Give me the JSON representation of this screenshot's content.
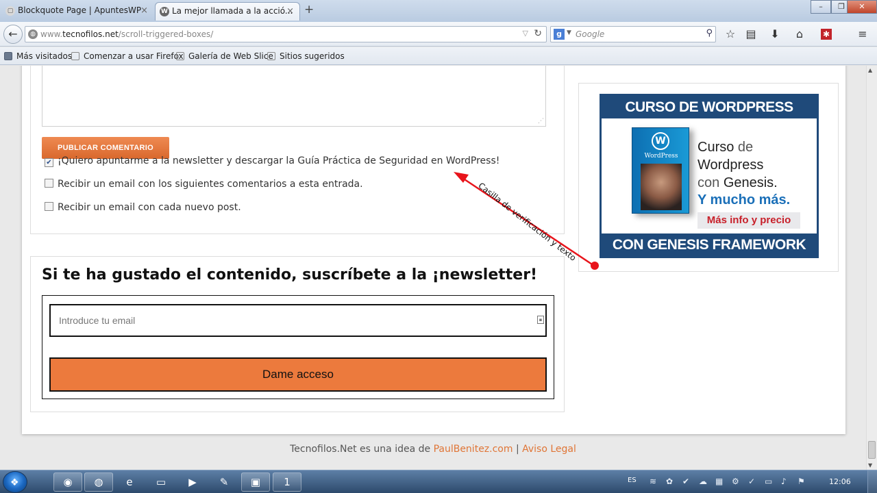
{
  "browser": {
    "tabs": [
      {
        "label": "Blockquote Page | ApuntesWP",
        "close": "×"
      },
      {
        "label": "La mejor llamada a la acció...",
        "close": "×"
      }
    ],
    "new_tab": "+",
    "window_controls": {
      "minimize": "–",
      "maximize": "❐",
      "close": "✕"
    },
    "url_prefix": "www.",
    "url_domain": "tecnofilos.net",
    "url_path": "/scroll-triggered-boxes/",
    "search_engine": "g",
    "search_placeholder": "Google",
    "bookmarks": [
      "Más visitados",
      "Comenzar a usar Firefox",
      "Galería de Web Slice",
      "Sitios sugeridos"
    ]
  },
  "comment_form": {
    "publish_button": "PUBLICAR COMENTARIO",
    "checkboxes": [
      {
        "label": "¡Quiero apuntarme a la newsletter y descargar la Guía Práctica de Seguridad en WordPress!",
        "checked": true
      },
      {
        "label": "Recibir un email con los siguientes comentarios a esta entrada.",
        "checked": false
      },
      {
        "label": "Recibir un email con cada nuevo post.",
        "checked": false
      }
    ]
  },
  "newsletter": {
    "title": "Si te ha gustado el contenido, suscríbete a la ¡newsletter!",
    "email_placeholder": "Introduce tu email",
    "submit_button": "Dame acceso"
  },
  "ad": {
    "top_banner": "CURSO DE WORDPRESS",
    "box_logo": "W",
    "box_brand": "WordPress",
    "line1_a": "Curso ",
    "line1_b": "de",
    "line2": "Wordpress",
    "line3_a": "con ",
    "line3_b": "Genesis.",
    "line4": "Y mucho más.",
    "price_button": "Más info y precio",
    "bottom_banner": "CON GENESIS FRAMEWORK"
  },
  "annotation": {
    "text": "Casilla de verificación y texto",
    "color": "#e8141b"
  },
  "footer": {
    "prefix": "Tecnofilos.Net es una idea de ",
    "link1": "PaulBenitez.com",
    "separator": " | ",
    "link2": "Aviso Legal"
  },
  "taskbar": {
    "language": "ES",
    "clock": "12:06"
  },
  "colors": {
    "accent_orange": "#ec7a3d",
    "link_orange": "#e07536",
    "ad_blue": "#1f4a7a"
  }
}
